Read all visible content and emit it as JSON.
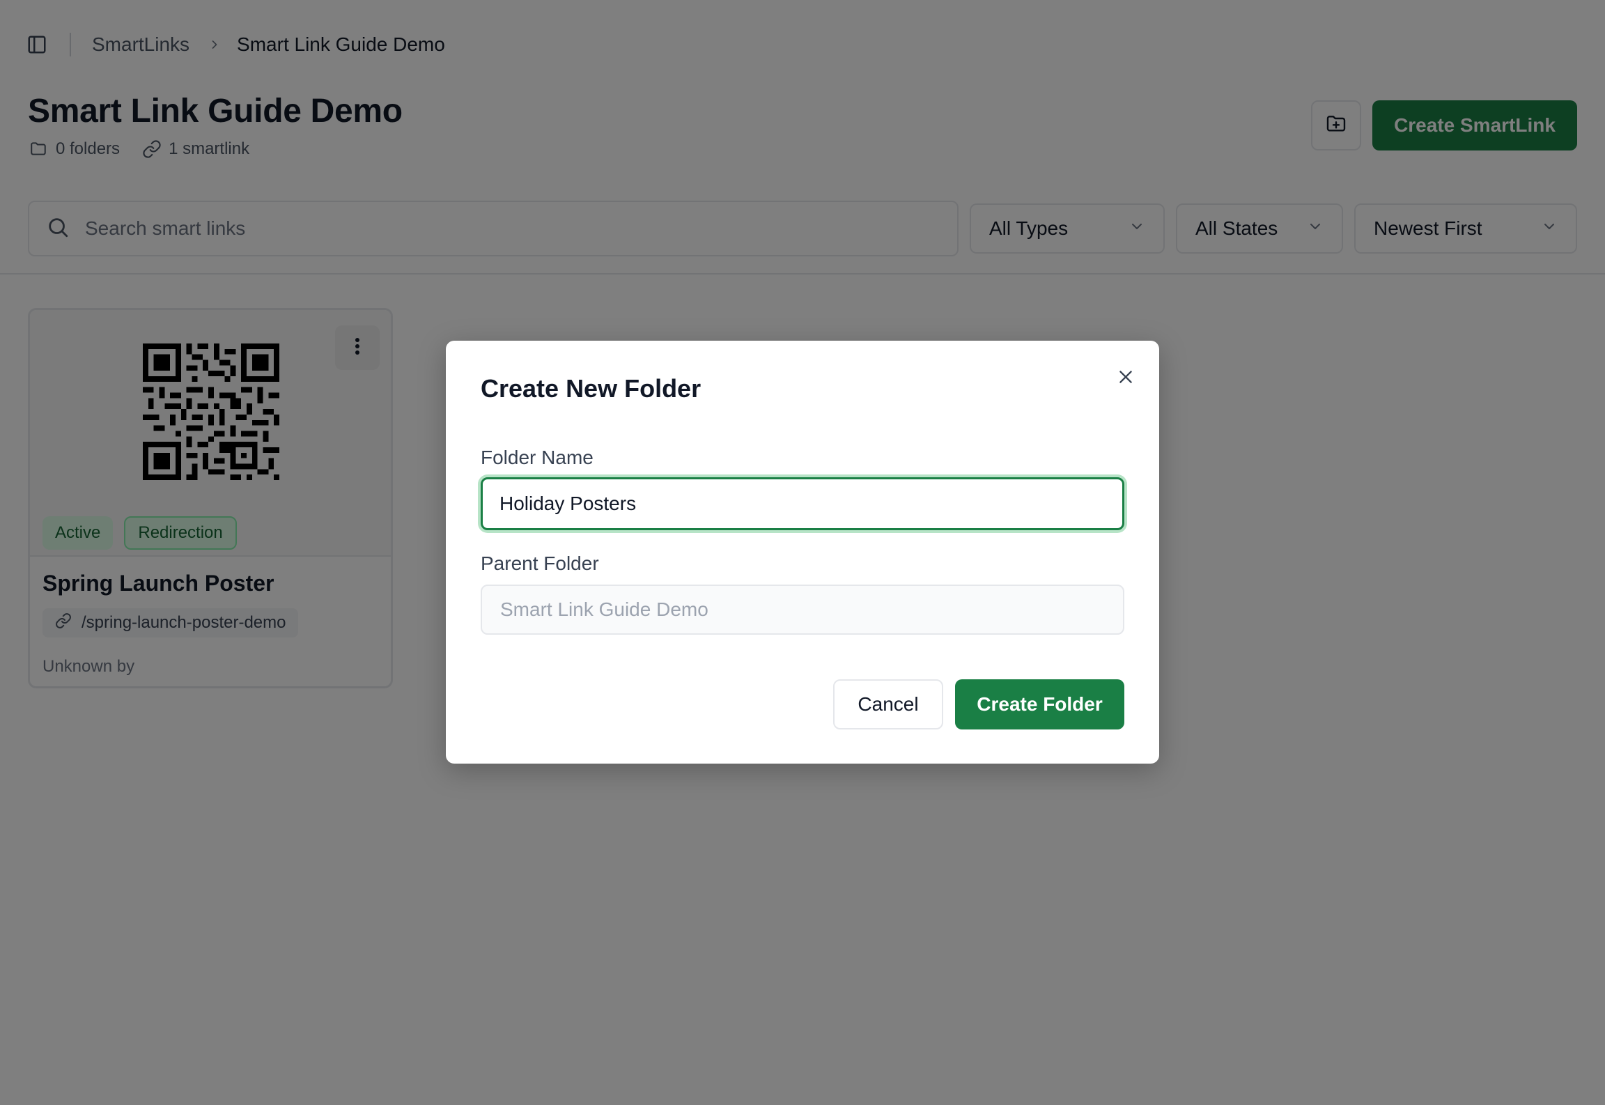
{
  "breadcrumb": {
    "parent": "SmartLinks",
    "current": "Smart Link Guide Demo"
  },
  "header": {
    "title": "Smart Link Guide Demo",
    "folders_count": "0 folders",
    "smartlinks_count": "1 smartlink",
    "create_button": "Create SmartLink"
  },
  "filters": {
    "search_placeholder": "Search smart links",
    "type": "All Types",
    "state": "All States",
    "sort": "Newest First"
  },
  "cards": [
    {
      "title": "Spring Launch Poster",
      "path": "/spring-launch-poster-demo",
      "owner": "Unknown by",
      "badges": [
        "Active",
        "Redirection"
      ]
    }
  ],
  "modal": {
    "title": "Create New Folder",
    "folder_name_label": "Folder Name",
    "folder_name_value": "Holiday Posters",
    "parent_folder_label": "Parent Folder",
    "parent_folder_placeholder": "Smart Link Guide Demo",
    "cancel_label": "Cancel",
    "create_label": "Create Folder"
  },
  "colors": {
    "primary_green": "#1a7f45",
    "overlay": "rgba(0,0,0,0.5)"
  },
  "icons": [
    "sidebar-toggle-icon",
    "chevron-right-icon",
    "folder-icon",
    "link-icon",
    "folder-plus-icon",
    "search-icon",
    "chevron-down-icon",
    "kebab-menu-icon",
    "qr-code-icon",
    "close-icon"
  ]
}
